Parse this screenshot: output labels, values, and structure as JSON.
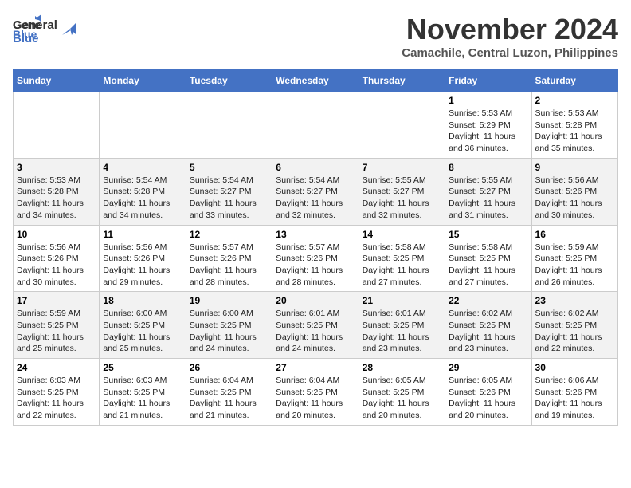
{
  "header": {
    "logo_line1": "General",
    "logo_line2": "Blue",
    "month": "November 2024",
    "location": "Camachile, Central Luzon, Philippines"
  },
  "weekdays": [
    "Sunday",
    "Monday",
    "Tuesday",
    "Wednesday",
    "Thursday",
    "Friday",
    "Saturday"
  ],
  "weeks": [
    [
      {
        "day": "",
        "info": ""
      },
      {
        "day": "",
        "info": ""
      },
      {
        "day": "",
        "info": ""
      },
      {
        "day": "",
        "info": ""
      },
      {
        "day": "",
        "info": ""
      },
      {
        "day": "1",
        "info": "Sunrise: 5:53 AM\nSunset: 5:29 PM\nDaylight: 11 hours\nand 36 minutes."
      },
      {
        "day": "2",
        "info": "Sunrise: 5:53 AM\nSunset: 5:28 PM\nDaylight: 11 hours\nand 35 minutes."
      }
    ],
    [
      {
        "day": "3",
        "info": "Sunrise: 5:53 AM\nSunset: 5:28 PM\nDaylight: 11 hours\nand 34 minutes."
      },
      {
        "day": "4",
        "info": "Sunrise: 5:54 AM\nSunset: 5:28 PM\nDaylight: 11 hours\nand 34 minutes."
      },
      {
        "day": "5",
        "info": "Sunrise: 5:54 AM\nSunset: 5:27 PM\nDaylight: 11 hours\nand 33 minutes."
      },
      {
        "day": "6",
        "info": "Sunrise: 5:54 AM\nSunset: 5:27 PM\nDaylight: 11 hours\nand 32 minutes."
      },
      {
        "day": "7",
        "info": "Sunrise: 5:55 AM\nSunset: 5:27 PM\nDaylight: 11 hours\nand 32 minutes."
      },
      {
        "day": "8",
        "info": "Sunrise: 5:55 AM\nSunset: 5:27 PM\nDaylight: 11 hours\nand 31 minutes."
      },
      {
        "day": "9",
        "info": "Sunrise: 5:56 AM\nSunset: 5:26 PM\nDaylight: 11 hours\nand 30 minutes."
      }
    ],
    [
      {
        "day": "10",
        "info": "Sunrise: 5:56 AM\nSunset: 5:26 PM\nDaylight: 11 hours\nand 30 minutes."
      },
      {
        "day": "11",
        "info": "Sunrise: 5:56 AM\nSunset: 5:26 PM\nDaylight: 11 hours\nand 29 minutes."
      },
      {
        "day": "12",
        "info": "Sunrise: 5:57 AM\nSunset: 5:26 PM\nDaylight: 11 hours\nand 28 minutes."
      },
      {
        "day": "13",
        "info": "Sunrise: 5:57 AM\nSunset: 5:26 PM\nDaylight: 11 hours\nand 28 minutes."
      },
      {
        "day": "14",
        "info": "Sunrise: 5:58 AM\nSunset: 5:25 PM\nDaylight: 11 hours\nand 27 minutes."
      },
      {
        "day": "15",
        "info": "Sunrise: 5:58 AM\nSunset: 5:25 PM\nDaylight: 11 hours\nand 27 minutes."
      },
      {
        "day": "16",
        "info": "Sunrise: 5:59 AM\nSunset: 5:25 PM\nDaylight: 11 hours\nand 26 minutes."
      }
    ],
    [
      {
        "day": "17",
        "info": "Sunrise: 5:59 AM\nSunset: 5:25 PM\nDaylight: 11 hours\nand 25 minutes."
      },
      {
        "day": "18",
        "info": "Sunrise: 6:00 AM\nSunset: 5:25 PM\nDaylight: 11 hours\nand 25 minutes."
      },
      {
        "day": "19",
        "info": "Sunrise: 6:00 AM\nSunset: 5:25 PM\nDaylight: 11 hours\nand 24 minutes."
      },
      {
        "day": "20",
        "info": "Sunrise: 6:01 AM\nSunset: 5:25 PM\nDaylight: 11 hours\nand 24 minutes."
      },
      {
        "day": "21",
        "info": "Sunrise: 6:01 AM\nSunset: 5:25 PM\nDaylight: 11 hours\nand 23 minutes."
      },
      {
        "day": "22",
        "info": "Sunrise: 6:02 AM\nSunset: 5:25 PM\nDaylight: 11 hours\nand 23 minutes."
      },
      {
        "day": "23",
        "info": "Sunrise: 6:02 AM\nSunset: 5:25 PM\nDaylight: 11 hours\nand 22 minutes."
      }
    ],
    [
      {
        "day": "24",
        "info": "Sunrise: 6:03 AM\nSunset: 5:25 PM\nDaylight: 11 hours\nand 22 minutes."
      },
      {
        "day": "25",
        "info": "Sunrise: 6:03 AM\nSunset: 5:25 PM\nDaylight: 11 hours\nand 21 minutes."
      },
      {
        "day": "26",
        "info": "Sunrise: 6:04 AM\nSunset: 5:25 PM\nDaylight: 11 hours\nand 21 minutes."
      },
      {
        "day": "27",
        "info": "Sunrise: 6:04 AM\nSunset: 5:25 PM\nDaylight: 11 hours\nand 20 minutes."
      },
      {
        "day": "28",
        "info": "Sunrise: 6:05 AM\nSunset: 5:25 PM\nDaylight: 11 hours\nand 20 minutes."
      },
      {
        "day": "29",
        "info": "Sunrise: 6:05 AM\nSunset: 5:26 PM\nDaylight: 11 hours\nand 20 minutes."
      },
      {
        "day": "30",
        "info": "Sunrise: 6:06 AM\nSunset: 5:26 PM\nDaylight: 11 hours\nand 19 minutes."
      }
    ]
  ]
}
